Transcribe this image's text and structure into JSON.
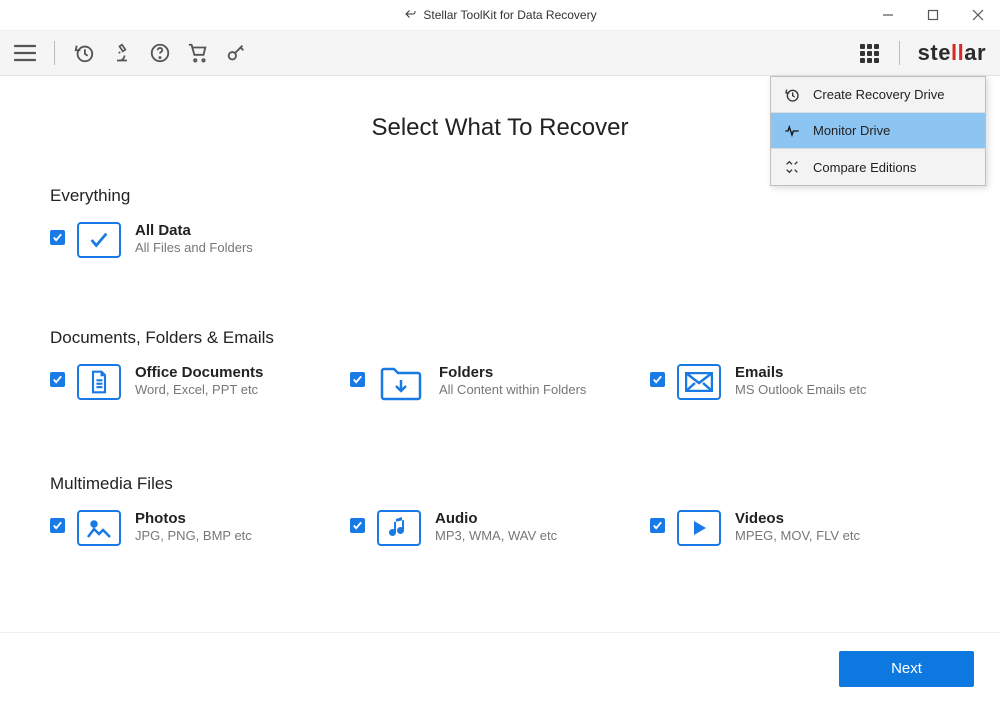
{
  "window": {
    "title": "Stellar ToolKit for Data Recovery"
  },
  "logo": {
    "pre": "ste",
    "accent": "ll",
    "post": "ar"
  },
  "dropdown": {
    "items": [
      {
        "label": "Create Recovery Drive",
        "icon": "clock-icon",
        "highlight": false
      },
      {
        "label": "Monitor Drive",
        "icon": "pulse-icon",
        "highlight": true
      },
      {
        "label": "Compare Editions",
        "icon": "compare-icon",
        "highlight": false
      }
    ]
  },
  "page": {
    "title": "Select What To Recover",
    "sections": [
      {
        "header": "Everything",
        "items": [
          {
            "title": "All Data",
            "sub": "All Files and Folders",
            "icon": "check-icon"
          }
        ]
      },
      {
        "header": "Documents, Folders & Emails",
        "items": [
          {
            "title": "Office Documents",
            "sub": "Word, Excel, PPT etc",
            "icon": "document-icon"
          },
          {
            "title": "Folders",
            "sub": "All Content within Folders",
            "icon": "folder-icon"
          },
          {
            "title": "Emails",
            "sub": "MS Outlook Emails etc",
            "icon": "mail-icon"
          }
        ]
      },
      {
        "header": "Multimedia Files",
        "items": [
          {
            "title": "Photos",
            "sub": "JPG, PNG, BMP etc",
            "icon": "image-icon"
          },
          {
            "title": "Audio",
            "sub": "MP3, WMA, WAV etc",
            "icon": "music-icon"
          },
          {
            "title": "Videos",
            "sub": "MPEG, MOV, FLV etc",
            "icon": "play-icon"
          }
        ]
      }
    ]
  },
  "footer": {
    "next": "Next"
  },
  "colors": {
    "accent": "#1a7ae5",
    "button": "#0d78e0",
    "highlight": "#8cc4f2"
  }
}
